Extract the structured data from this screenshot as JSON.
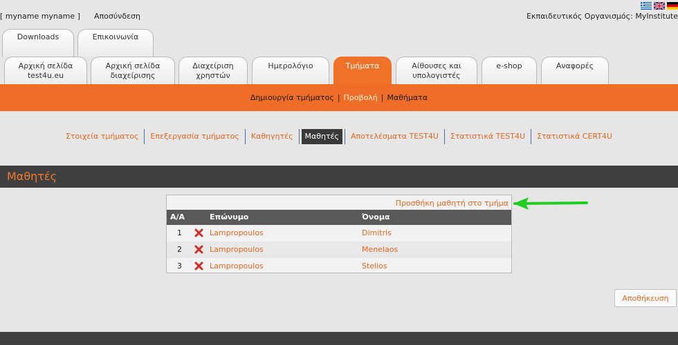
{
  "header": {
    "user": "[ myname myname ]",
    "logout": "Αποσύνδεση",
    "organization": "Εκπαιδευτικός Οργανισμός: MyInstitute"
  },
  "languages": [
    "greek-flag-icon",
    "uk-flag-icon",
    "german-flag-icon"
  ],
  "tabs_row1": [
    {
      "label": "Downloads"
    },
    {
      "label": "Επικοινωνία"
    }
  ],
  "tabs_row2": [
    {
      "line1": "Αρχική σελίδα",
      "line2": "test4u.eu"
    },
    {
      "line1": "Αρχική σελίδα",
      "line2": "διαχείρισης"
    },
    {
      "line1": "Διαχείριση",
      "line2": "χρηστών"
    },
    {
      "line1": "Ημερολόγιο",
      "line2": ""
    },
    {
      "line1": "Τμήματα",
      "line2": ""
    },
    {
      "line1": "Αίθουσες και",
      "line2": "υπολογιστές"
    },
    {
      "line1": "e-shop",
      "line2": ""
    },
    {
      "line1": "Αναφορές",
      "line2": ""
    }
  ],
  "nav": {
    "create": "Δημιουργία τμήματος",
    "view": "Προβολή",
    "lessons": "Μαθήματα"
  },
  "subnav": [
    "Στοιχεία τμήματος",
    "Επεξεργασία τμήματος",
    "Καθηγητές",
    "Μαθητές",
    "Αποτελέσματα TEST4U",
    "Στατιστικά TEST4U",
    "Στατιστικά CERT4U"
  ],
  "section": {
    "title": "Μαθητές"
  },
  "table": {
    "add_link": "Προσθήκη μαθητή στο τμήμα",
    "headers": {
      "num": "Α/Α",
      "surname": "Επώνυμο",
      "firstname": "Όνομα"
    },
    "rows": [
      {
        "num": "1",
        "surname": "Lampropoulos",
        "firstname": "Dimitris"
      },
      {
        "num": "2",
        "surname": "Lampropoulos",
        "firstname": "Menelaos"
      },
      {
        "num": "3",
        "surname": "Lampropoulos",
        "firstname": "Stelios"
      }
    ]
  },
  "save_button": "Αποθήκευση",
  "colors": {
    "accent": "#ef6d27",
    "dark": "#3f3f3f",
    "link": "#e4661f",
    "annotation_arrow": "#22cc22"
  }
}
